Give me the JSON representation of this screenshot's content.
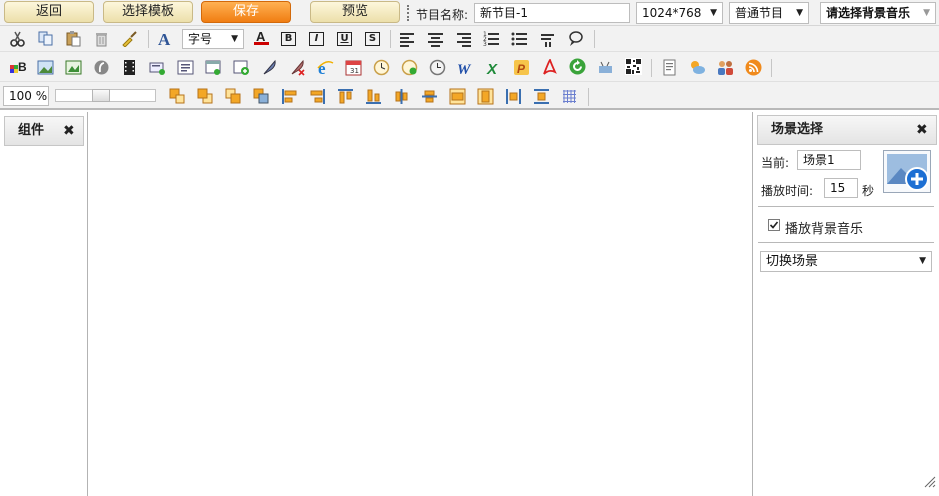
{
  "toolbar": {
    "back_label": "返回",
    "template_label": "选择模板",
    "save_label": "保存",
    "preview_label": "预览",
    "program_name_label": "节目名称:",
    "program_name_value": "新节目-1",
    "resolution_value": "1024*768",
    "program_type_value": "普通节目",
    "bg_music_value": "请选择背景音乐"
  },
  "format_bar": {
    "font_size_value": "字号",
    "bold_label": "B",
    "italic_label": "I",
    "underline_label": "U",
    "strike_label": "S"
  },
  "zoom": {
    "level_text": "100 %",
    "slider_value": 0.45
  },
  "components_panel": {
    "title": "组件"
  },
  "scene_panel": {
    "title": "场景选择",
    "current_label": "当前:",
    "current_value": "场景1",
    "duration_label": "播放时间:",
    "duration_value": "15",
    "duration_unit": "秒",
    "bg_music_label": "播放背景音乐",
    "bg_music_checked": true,
    "switch_value": "切换场景"
  },
  "icons": {
    "row2": [
      "cut-icon",
      "copy-icon",
      "paste-icon",
      "delete-icon",
      "clear-format-icon",
      "font-icon",
      "font-color-icon",
      "bold-icon",
      "italic-icon",
      "underline-icon",
      "strike-icon",
      "align-left-icon",
      "align-center-icon",
      "align-right-icon",
      "ordered-list-icon",
      "unordered-list-icon",
      "paragraph-icon",
      "link-icon"
    ],
    "row3": [
      "colorful-text-icon",
      "image-icon",
      "picture-icon",
      "flash-icon",
      "video-icon",
      "scrolling-text-icon",
      "text-box-icon",
      "web-window-icon",
      "add-window-icon",
      "feather-icon",
      "feather-delete-icon",
      "ie-icon",
      "calendar-icon",
      "clock-analog-icon",
      "clock-refresh-icon",
      "clock-icon",
      "word-icon",
      "excel-icon",
      "powerpoint-icon",
      "pdf-icon",
      "refresh-icon",
      "tv-icon",
      "qrcode-icon",
      "notice-icon",
      "weather-icon",
      "people-icon",
      "rss-icon"
    ],
    "row4": [
      "bring-front-icon",
      "bring-forward-icon",
      "send-backward-icon",
      "send-back-icon",
      "align-left-edge-icon",
      "align-right-edge-icon",
      "align-top-edge-icon",
      "align-bottom-edge-icon",
      "align-h-center-icon",
      "align-v-center-icon",
      "same-width-icon",
      "same-height-icon",
      "distribute-h-icon",
      "distribute-v-icon",
      "grid-icon"
    ]
  },
  "colors": {
    "save": "#f07d12",
    "accent": "#e8a33a",
    "font_color_line": "#cc0000"
  }
}
